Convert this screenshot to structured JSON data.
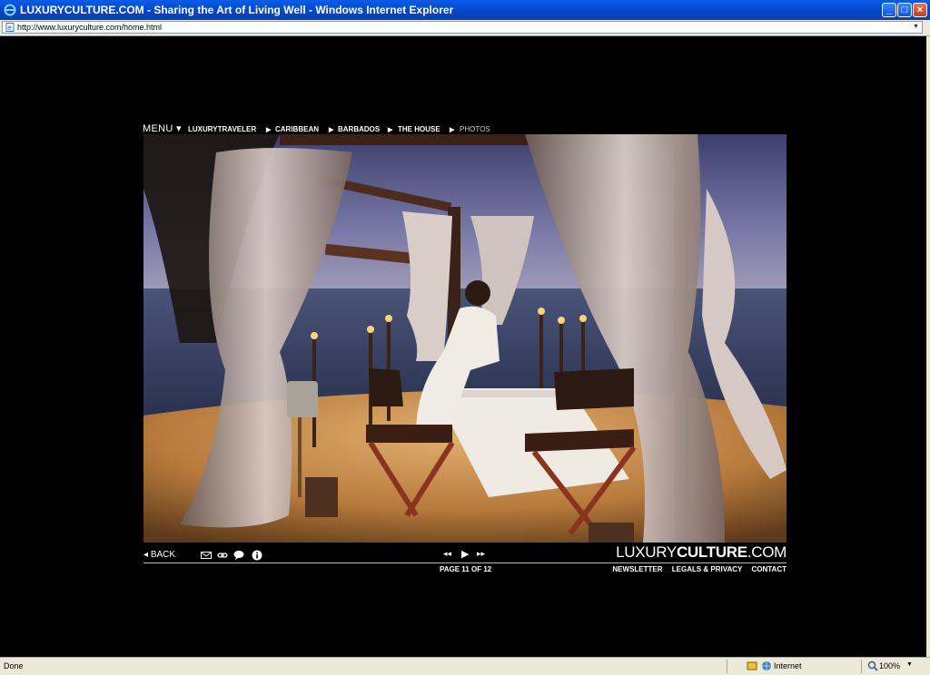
{
  "window": {
    "title": "LUXURYCULTURE.COM - Sharing the Art of Living Well - Windows Internet Explorer",
    "minimize_glyph": "_",
    "maximize_glyph": "□",
    "close_glyph": "×"
  },
  "address": {
    "url": "http://www.luxuryculture.com/home.html"
  },
  "nav": {
    "menu_label": "MENU ▾",
    "breadcrumbs": [
      "LUXURYTRAVELER",
      "CARIBBEAN",
      "BARBADOS",
      "THE HOUSE",
      "PHOTOS"
    ],
    "arrow": "▶"
  },
  "footer": {
    "back_label": "BACK",
    "brand_light": "LUXURY",
    "brand_bold": "CULTURE",
    "brand_suffix": ".COM",
    "page_info": "PAGE 11 OF 12",
    "links": [
      "NEWSLETTER",
      "LEGALS & PRIVACY",
      "CONTACT"
    ],
    "tool_icons": [
      "email-icon",
      "link-icon",
      "comment-icon",
      "info-icon"
    ],
    "playback_icons": [
      "rewind-icon",
      "play-icon",
      "fast-forward-icon"
    ]
  },
  "status": {
    "text": "Done",
    "zone": "Internet",
    "zoom": "100%"
  },
  "colors": {
    "titlebar": "#0447c8",
    "chrome": "#ece9d8",
    "page_bg": "#000000"
  }
}
